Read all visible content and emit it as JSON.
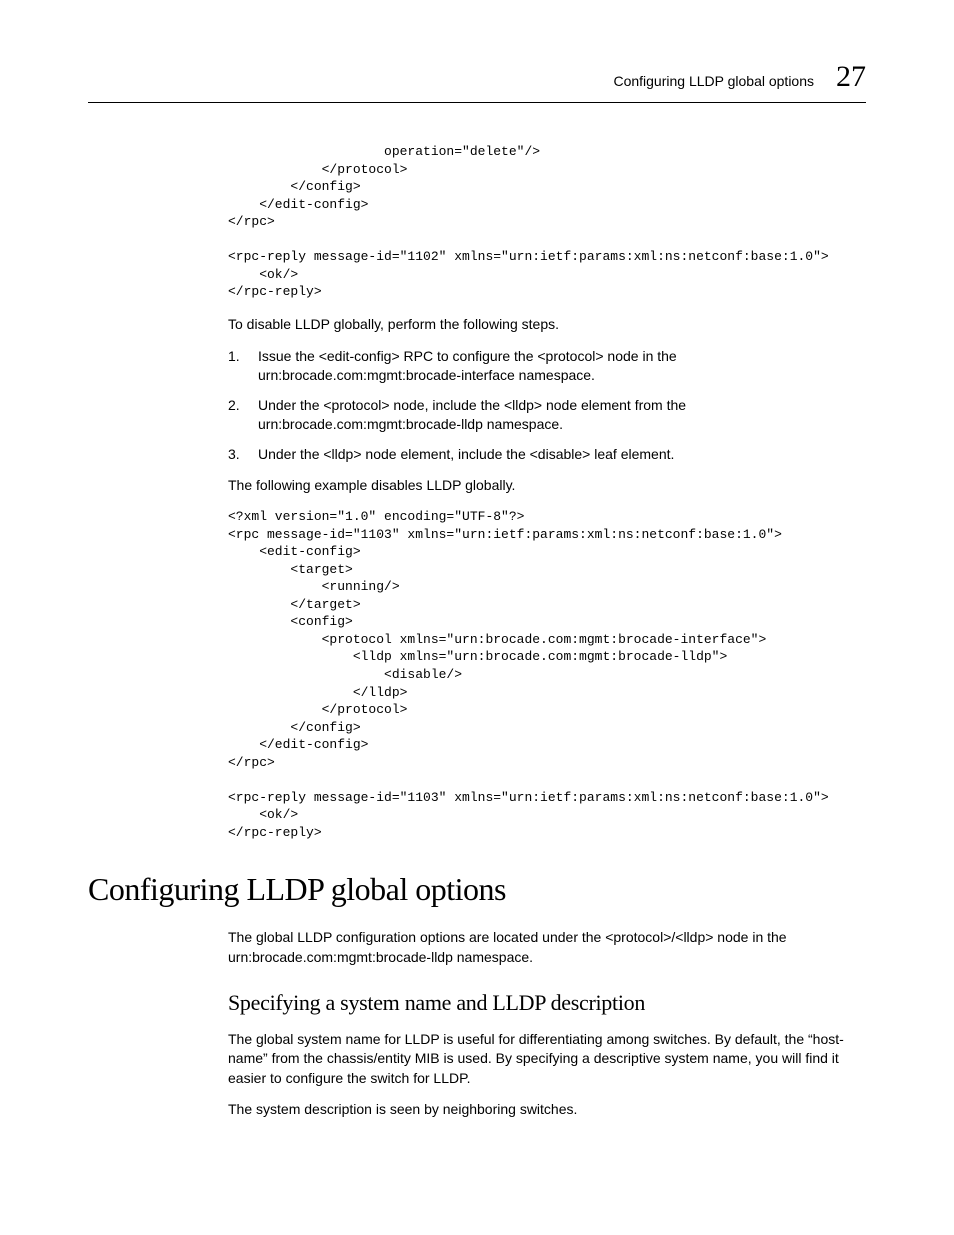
{
  "header": {
    "title": "Configuring LLDP global options",
    "chapter_number": "27"
  },
  "code_block_1": "                    operation=\"delete\"/>\n            </protocol>\n        </config>\n    </edit-config>\n</rpc>\n\n<rpc-reply message-id=\"1102\" xmlns=\"urn:ietf:params:xml:ns:netconf:base:1.0\">\n    <ok/>\n</rpc-reply>",
  "intro_text": "To disable LLDP globally, perform the following steps.",
  "steps": [
    {
      "num": "1.",
      "text": "Issue the <edit-config> RPC to configure the <protocol> node in the urn:brocade.com:mgmt:brocade-interface namespace."
    },
    {
      "num": "2.",
      "text": "Under the <protocol> node, include the <lldp> node element from the urn:brocade.com:mgmt:brocade-lldp namespace."
    },
    {
      "num": "3.",
      "text": "Under the <lldp> node element, include the <disable> leaf element."
    }
  ],
  "example_intro": "The following example disables LLDP globally.",
  "code_block_2": "<?xml version=\"1.0\" encoding=\"UTF-8\"?>\n<rpc message-id=\"1103\" xmlns=\"urn:ietf:params:xml:ns:netconf:base:1.0\">\n    <edit-config>\n        <target>\n            <running/>\n        </target>\n        <config>\n            <protocol xmlns=\"urn:brocade.com:mgmt:brocade-interface\">\n                <lldp xmlns=\"urn:brocade.com:mgmt:brocade-lldp\">\n                    <disable/>\n                </lldp>\n            </protocol>\n        </config>\n    </edit-config>\n</rpc>\n\n<rpc-reply message-id=\"1103\" xmlns=\"urn:ietf:params:xml:ns:netconf:base:1.0\">\n    <ok/>\n</rpc-reply>",
  "section": {
    "h1": "Configuring LLDP global options",
    "para1": "The global LLDP configuration options are located under the <protocol>/<lldp> node in the urn:brocade.com:mgmt:brocade-lldp namespace.",
    "h2": "Specifying a system name and LLDP description",
    "para2": "The global system name for LLDP is useful for differentiating among switches. By default, the “host-name” from the chassis/entity MIB is used. By specifying a descriptive system name, you will find it easier to configure the switch for LLDP.",
    "para3": "The system description is seen by neighboring switches."
  }
}
